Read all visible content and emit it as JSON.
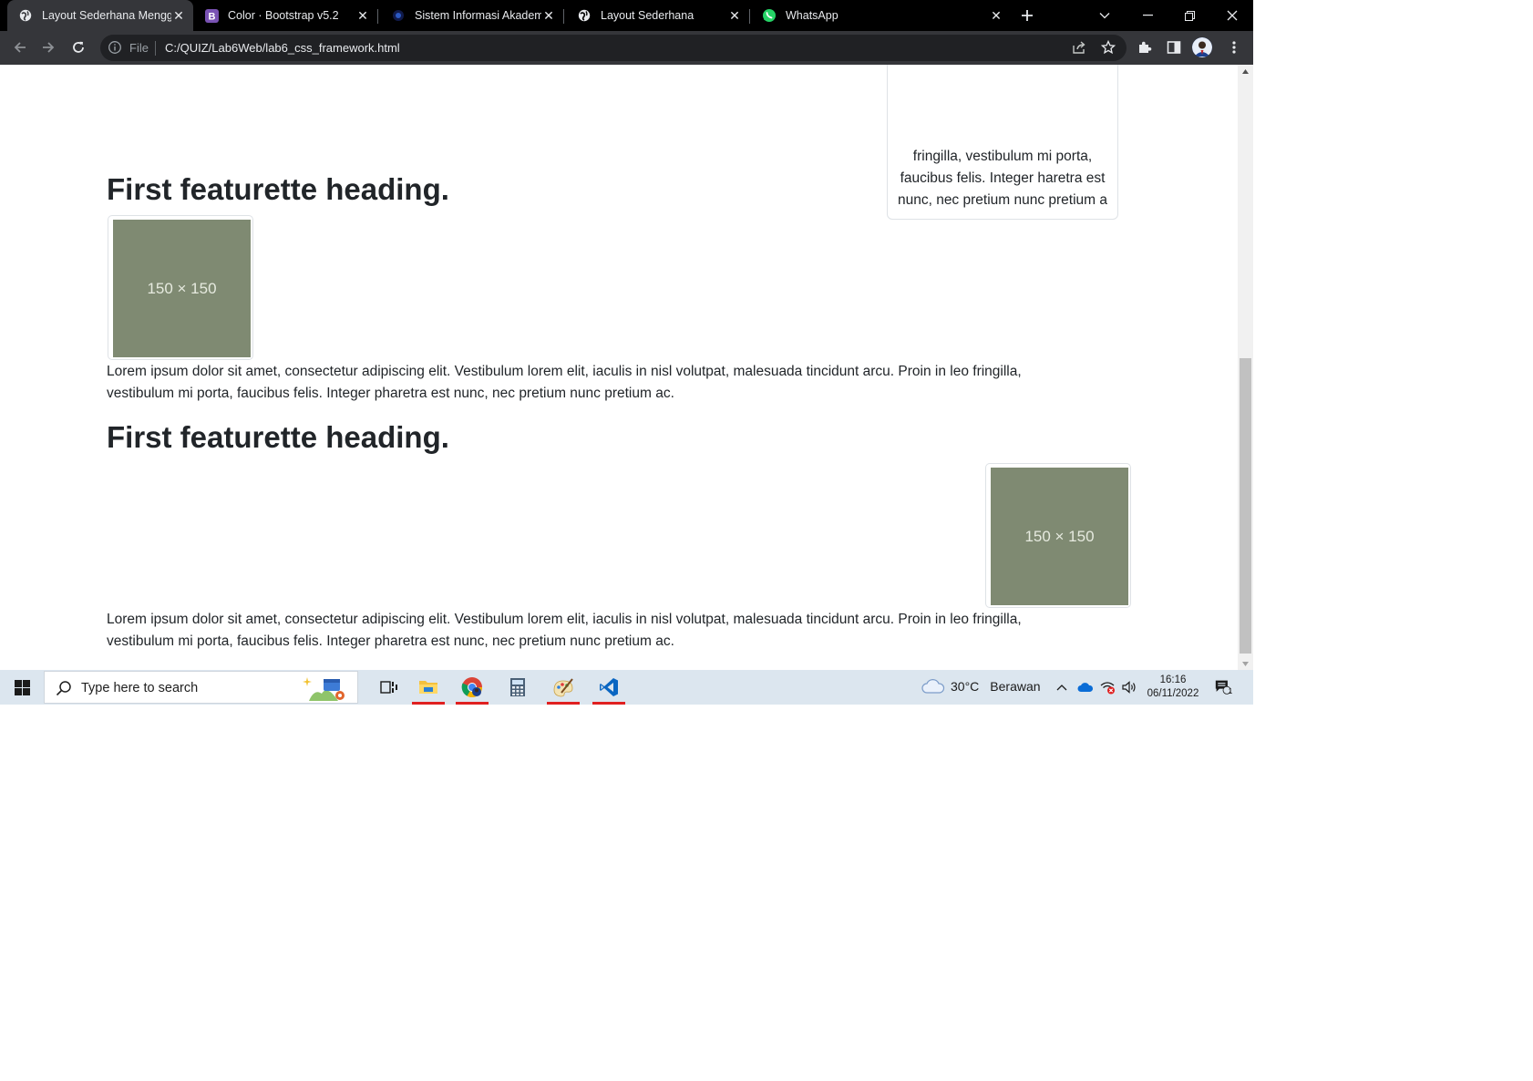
{
  "browser": {
    "tabs": [
      {
        "title": "Layout Sederhana Menggunakan",
        "icon": "globe-icon",
        "active": true
      },
      {
        "title": "Color · Bootstrap v5.2",
        "icon": "bootstrap-icon",
        "active": false
      },
      {
        "title": "Sistem Informasi Akademik",
        "icon": "university-icon",
        "active": false
      },
      {
        "title": "Layout Sederhana",
        "icon": "globe-icon",
        "active": false
      },
      {
        "title": "WhatsApp",
        "icon": "whatsapp-icon",
        "active": false
      }
    ],
    "address": {
      "scheme_label": "File",
      "url": "C:/QUIZ/Lab6Web/lab6_css_framework.html"
    }
  },
  "page": {
    "card_text": "fringilla, vestibulum mi porta, faucibus felis. Integer haretra est nunc, nec pretium nunc pretium a",
    "features": [
      {
        "heading": "First featurette heading.",
        "image_label": "150 × 150",
        "text": "Lorem ipsum dolor sit amet, consectetur adipiscing elit. Vestibulum lorem elit, iaculis in nisl volutpat, malesuada tincidunt arcu. Proin in leo fringilla, vestibulum mi porta, faucibus felis. Integer pharetra est nunc, nec pretium nunc pretium ac."
      },
      {
        "heading": "First featurette heading.",
        "image_label": "150 × 150",
        "text": "Lorem ipsum dolor sit amet, consectetur adipiscing elit. Vestibulum lorem elit, iaculis in nisl volutpat, malesuada tincidunt arcu. Proin in leo fringilla, vestibulum mi porta, faucibus felis. Integer pharetra est nunc, nec pretium nunc pretium ac."
      }
    ],
    "placeholder_color": "#7f8a72"
  },
  "taskbar": {
    "search_placeholder": "Type here to search",
    "weather": {
      "temp": "30°C",
      "condition": "Berawan"
    },
    "clock": {
      "time": "16:16",
      "date": "06/11/2022"
    },
    "notification_count": "1",
    "apps": [
      "task-view-icon",
      "file-explorer-icon",
      "chrome-icon",
      "calculator-icon",
      "paint-icon",
      "vscode-icon"
    ]
  }
}
